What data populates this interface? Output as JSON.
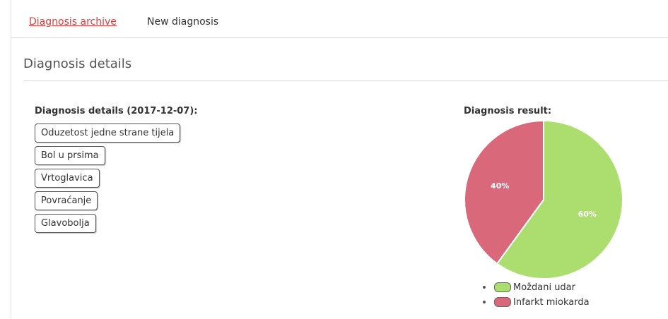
{
  "nav": {
    "tabs": [
      {
        "label": "Diagnosis archive",
        "active": true
      },
      {
        "label": "New diagnosis",
        "active": false
      }
    ]
  },
  "page": {
    "title": "Diagnosis details"
  },
  "details": {
    "heading": "Diagnosis details (2017-12-07):",
    "symptoms": [
      "Oduzetost jedne strane tijela",
      "Bol u prsima",
      "Vrtoglavica",
      "Povraćanje",
      "Glavobolja"
    ]
  },
  "result": {
    "heading": "Diagnosis result:"
  },
  "colors": {
    "accent": "#e23b3b",
    "green": "#abde6e",
    "red": "#d9687a"
  },
  "chart_data": {
    "type": "pie",
    "categories": [
      "Moždani udar",
      "Infarkt miokarda"
    ],
    "values": [
      60,
      40
    ],
    "value_labels": [
      "60%",
      "40%"
    ],
    "colors": [
      "#abde6e",
      "#d9687a"
    ],
    "legend_position": "bottom"
  }
}
